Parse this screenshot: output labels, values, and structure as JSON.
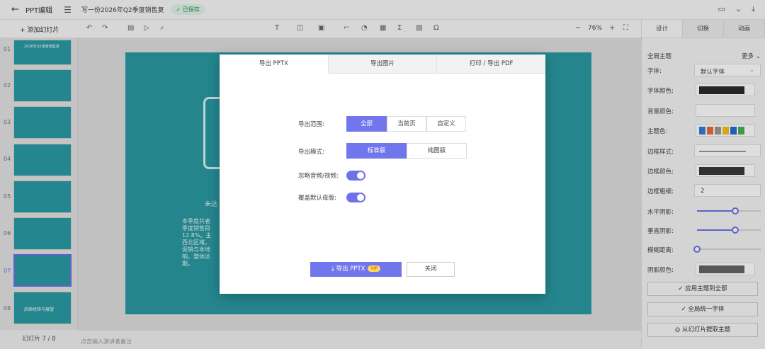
{
  "topbar": {
    "app_title": "PPT编辑",
    "doc_title": "写一份2026年Q2季度销售复",
    "saved_badge": "✓ 已保存"
  },
  "toolbar": {
    "add_slide": "+ 添加幻灯片",
    "zoom_value": "76%"
  },
  "thumbnails": [
    {
      "num": "01"
    },
    {
      "num": "02"
    },
    {
      "num": "03"
    },
    {
      "num": "04"
    },
    {
      "num": "05"
    },
    {
      "num": "06"
    },
    {
      "num": "07"
    },
    {
      "num": "08"
    }
  ],
  "thumb_texts": {
    "t1": "2026年Q2季度销售复",
    "t8": "后续经验与展望"
  },
  "slide_counter": "幻灯片 7 / 8",
  "notes_placeholder": "点击输入演讲者备注",
  "slide": {
    "heading": "未达",
    "body": "本季度共者\n季度销售目\n12.8%。主\n西北区域，\n促销与本地\n响，整体达\n期。"
  },
  "right_panel": {
    "tabs": [
      "设计",
      "切换",
      "动画"
    ],
    "global_theme": "全局主题",
    "more": "更多",
    "font_label": "字体:",
    "font_value": "默认字体",
    "font_color_label": "字体颜色:",
    "bg_color_label": "背景颜色:",
    "theme_color_label": "主题色:",
    "border_style_label": "边框样式:",
    "border_color_label": "边框颜色:",
    "border_width_label": "边框粗细:",
    "border_width_value": "2",
    "h_shadow_label": "水平阴影:",
    "v_shadow_label": "垂直阴影:",
    "blur_label": "模糊距离:",
    "shadow_color_label": "阴影颜色:",
    "apply_all": "✓ 应用主题到全部",
    "unify_font": "✓ 全局统一字体",
    "extract_theme": "从幻灯片提取主题",
    "sliders": {
      "h_shadow": 0.6,
      "v_shadow": 0.6,
      "blur": 0.0
    },
    "colors": {
      "font": "#2b2b2b",
      "border": "#3a3a3a",
      "shadow": "#666666",
      "accent": "#6d72e8",
      "theme": [
        "#3a7bd5",
        "#e86a3a",
        "#999999",
        "#f2c21b",
        "#2a6bd4",
        "#4caf50"
      ]
    }
  },
  "dialog": {
    "tabs": [
      "导出 PPTX",
      "导出图片",
      "打印 / 导出 PDF"
    ],
    "range_label": "导出范围:",
    "range_options": [
      "全部",
      "当前页",
      "自定义"
    ],
    "mode_label": "导出模式:",
    "mode_options": [
      "标准版",
      "纯图版"
    ],
    "ignore_media_label": "忽略音频/视频:",
    "override_master_label": "覆盖默认母版:",
    "export_btn": "⤓ 导出 PPTX",
    "vip": "VIP",
    "close_btn": "关闭"
  }
}
